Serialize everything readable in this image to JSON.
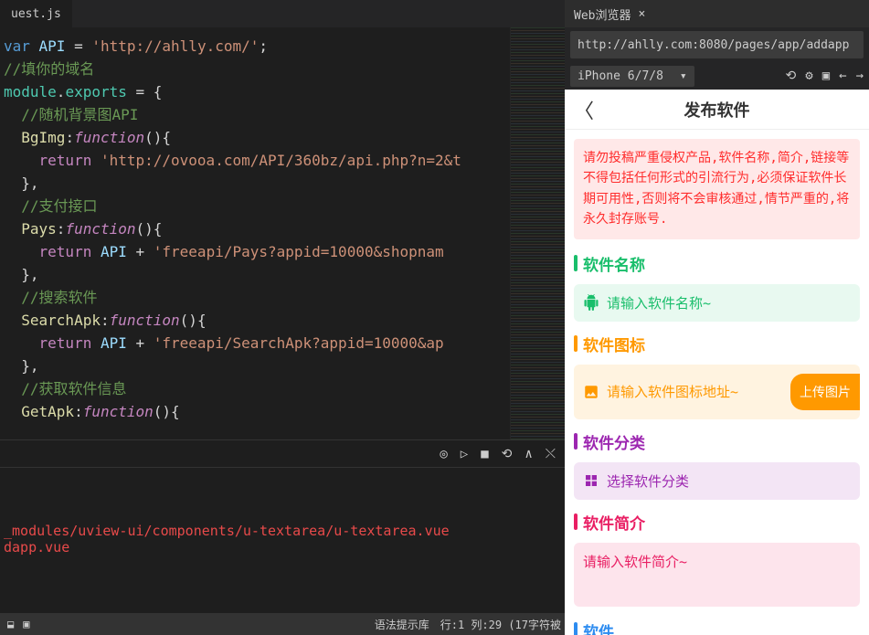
{
  "editor": {
    "tab": "uest.js",
    "lines": {
      "l1_var": "var",
      "l1_api": " API ",
      "l1_eq": "= ",
      "l1_str": "'http://ahlly.com/'",
      "l1_semi": ";",
      "l2": "//填你的域名",
      "l3a": "module",
      "l3b": ".",
      "l3c": "exports",
      "l3d": " = {",
      "l4": "  //随机背景图API",
      "l5a": "  BgImg",
      "l5b": ":",
      "l5c": "function",
      "l5d": "(){",
      "l6a": "    return",
      "l6b": " 'http://ovooa.com/API/360bz/api.php?n=2&t",
      "l7": "  },",
      "l8": "  //支付接口",
      "l9a": "  Pays",
      "l9b": ":",
      "l9c": "function",
      "l9d": "(){",
      "l10a": "    return",
      "l10b": " API ",
      "l10c": "+ ",
      "l10d": "'freeapi/Pays?appid=10000&shopnam",
      "l11": "  },",
      "l12": "  //搜索软件",
      "l13a": "  SearchApk",
      "l13b": ":",
      "l13c": "function",
      "l13d": "(){",
      "l14a": "    return",
      "l14b": " API ",
      "l14c": "+ ",
      "l14d": "'freeapi/SearchApk?appid=10000&ap",
      "l15": "  },",
      "l16": "  //获取软件信息",
      "l17a": "  GetApk",
      "l17b": ":",
      "l17c": "function",
      "l17d": "(){"
    }
  },
  "terminal": {
    "line1": "_modules/uview-ui/components/u-textarea/u-textarea.vue",
    "line2": "dapp.vue"
  },
  "status": {
    "syntax": "语法提示库",
    "pos": "行:1 列:29 (17字符被"
  },
  "browser": {
    "title": "Web浏览器",
    "url": "http://ahlly.com:8080/pages/app/addapp",
    "device": "iPhone 6/7/8"
  },
  "preview": {
    "back": "〈",
    "title": "发布软件",
    "warning": "请勿投稿严重侵权产品,软件名称,简介,链接等不得包括任何形式的引流行为,必须保证软件长期可用性,否则将不会审核通过,情节严重的,将永久封存账号.",
    "sections": {
      "name_label": "软件名称",
      "name_ph": "请输入软件名称~",
      "icon_label": "软件图标",
      "icon_ph": "请输入软件图标地址~",
      "upload_btn": "上传图片",
      "cat_label": "软件分类",
      "cat_ph": "选择软件分类",
      "desc_label": "软件简介",
      "desc_ph": "请输入软件简介~",
      "next_label": "软件"
    }
  }
}
